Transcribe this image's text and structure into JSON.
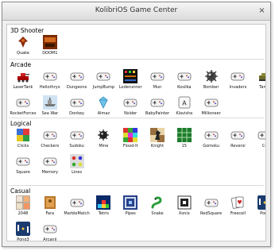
{
  "window": {
    "title": "KolibriOS Game Center",
    "close_glyph": "×"
  },
  "sections": [
    {
      "title": "3D Shooter",
      "games": [
        {
          "label": "Quake",
          "icon": "quake-icon"
        },
        {
          "label": "DOOM1",
          "icon": "doom-icon"
        }
      ]
    },
    {
      "title": "Arcade",
      "games": [
        {
          "label": "LaserTank",
          "icon": "lasertank-icon"
        },
        {
          "label": "Heliothryx",
          "icon": "gamepad-icon"
        },
        {
          "label": "Dungeons",
          "icon": "gamepad-icon"
        },
        {
          "label": "JumpBump",
          "icon": "gamepad-icon"
        },
        {
          "label": "Loderunner",
          "icon": "loderunner-icon"
        },
        {
          "label": "Mun",
          "icon": "gamepad-icon"
        },
        {
          "label": "Kosilka",
          "icon": "gamepad-icon"
        },
        {
          "label": "Bomber",
          "icon": "bomber-icon"
        },
        {
          "label": "Invaders",
          "icon": "gamepad-icon"
        },
        {
          "label": "Tanks",
          "icon": "tanks-icon"
        },
        {
          "label": "RocketForces",
          "icon": "gamepad-icon"
        },
        {
          "label": "Sea War",
          "icon": "seawar-icon"
        },
        {
          "label": "Donkey",
          "icon": "gamepad-icon"
        },
        {
          "label": "Almaz",
          "icon": "diamond-icon"
        },
        {
          "label": "Nsider",
          "icon": "gamepad-icon"
        },
        {
          "label": "BabyPainter",
          "icon": "gamepad-icon"
        },
        {
          "label": "Klavisha",
          "icon": "key-icon"
        },
        {
          "label": "Millioneer",
          "icon": "gamepad-icon"
        }
      ]
    },
    {
      "title": "Logical",
      "games": [
        {
          "label": "Clicks",
          "icon": "clicks-icon"
        },
        {
          "label": "Checkers",
          "icon": "gamepad-icon"
        },
        {
          "label": "Sudoku",
          "icon": "gamepad-icon"
        },
        {
          "label": "Mine",
          "icon": "mine-icon"
        },
        {
          "label": "Flood-It",
          "icon": "floodit-icon"
        },
        {
          "label": "Knight",
          "icon": "knight-icon"
        },
        {
          "label": "15",
          "icon": "fifteen-icon"
        },
        {
          "label": "Gomoku",
          "icon": "gamepad-icon"
        },
        {
          "label": "Reversi",
          "icon": "gamepad-icon"
        },
        {
          "label": "C4",
          "icon": "gamepad-icon"
        },
        {
          "label": "Square",
          "icon": "gamepad-icon"
        },
        {
          "label": "Memory",
          "icon": "gamepad-icon"
        },
        {
          "label": "Lines",
          "icon": "lines-icon"
        }
      ]
    },
    {
      "title": "Casual",
      "games": [
        {
          "label": "2048",
          "icon": "tiles-2048-icon"
        },
        {
          "label": "Fara",
          "icon": "fara-icon"
        },
        {
          "label": "MarbleMatch",
          "icon": "gamepad-icon"
        },
        {
          "label": "Tetris",
          "icon": "tetris-icon"
        },
        {
          "label": "Pipes",
          "icon": "pipes-icon"
        },
        {
          "label": "Snake",
          "icon": "snake-icon"
        },
        {
          "label": "Xonix",
          "icon": "xonix-icon"
        },
        {
          "label": "RedSquare",
          "icon": "gamepad-icon"
        },
        {
          "label": "Freecell",
          "icon": "cards-icon"
        },
        {
          "label": "Pong",
          "icon": "pong-icon"
        },
        {
          "label": "Pong3",
          "icon": "pong-icon"
        },
        {
          "label": "Arcanii",
          "icon": "gamepad-icon"
        }
      ]
    }
  ]
}
